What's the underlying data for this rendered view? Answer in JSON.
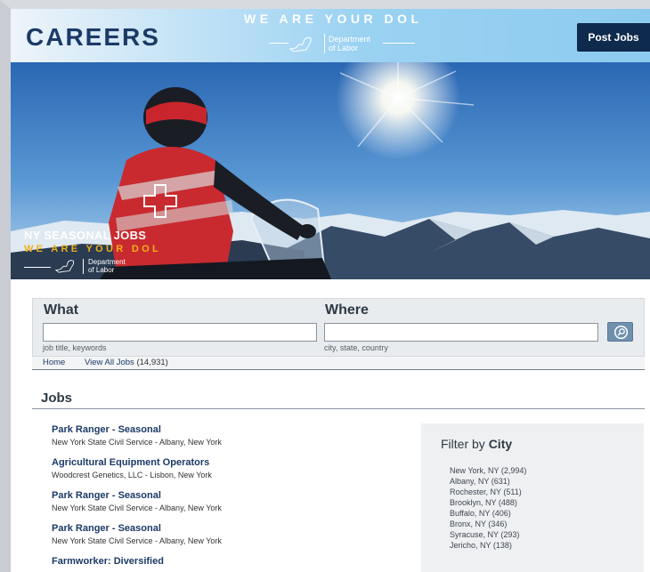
{
  "header": {
    "title": "CAREERS",
    "tagline": "WE ARE YOUR DOL",
    "agency_line1": "Department",
    "agency_line2": "of Labor",
    "post_jobs_label": "Post Jobs"
  },
  "hero": {
    "title": "NY SEASONAL JOBS",
    "tagline": "WE ARE YOUR DOL",
    "agency_line1": "Department",
    "agency_line2": "of Labor"
  },
  "search": {
    "what_label": "What",
    "what_value": "",
    "what_hint": "job title, keywords",
    "where_label": "Where",
    "where_value": "",
    "where_hint": "city, state, country"
  },
  "breadcrumb": {
    "home": "Home",
    "view_all": "View All Jobs",
    "count": "(14,931)"
  },
  "jobs": {
    "heading": "Jobs",
    "items": [
      {
        "title": "Park Ranger - Seasonal",
        "subtitle": "New York State Civil Service - Albany, New York"
      },
      {
        "title": "Agricultural Equipment Operators",
        "subtitle": "Woodcrest Genetics, LLC - Lisbon, New York"
      },
      {
        "title": "Park Ranger - Seasonal",
        "subtitle": "New York State Civil Service - Albany, New York"
      },
      {
        "title": "Park Ranger - Seasonal",
        "subtitle": "New York State Civil Service - Albany, New York"
      },
      {
        "title": "Farmworker: Diversified",
        "subtitle": ""
      }
    ]
  },
  "filter": {
    "label": "Filter by",
    "field": "City",
    "cities": [
      "New York, NY (2,994)",
      "Albany, NY (631)",
      "Rochester, NY (511)",
      "Brooklyn, NY (488)",
      "Buffalo, NY (406)",
      "Bronx, NY (346)",
      "Syracuse, NY (293)",
      "Jericho, NY (138)"
    ]
  },
  "icons": {
    "search": "search-icon",
    "state_logo": "ny-state-logo"
  },
  "colors": {
    "brand_navy": "#1b3a66",
    "button_dark": "#0e2a4d",
    "hero_tagline": "#f0b019",
    "panel_gray": "#e9ecef"
  }
}
